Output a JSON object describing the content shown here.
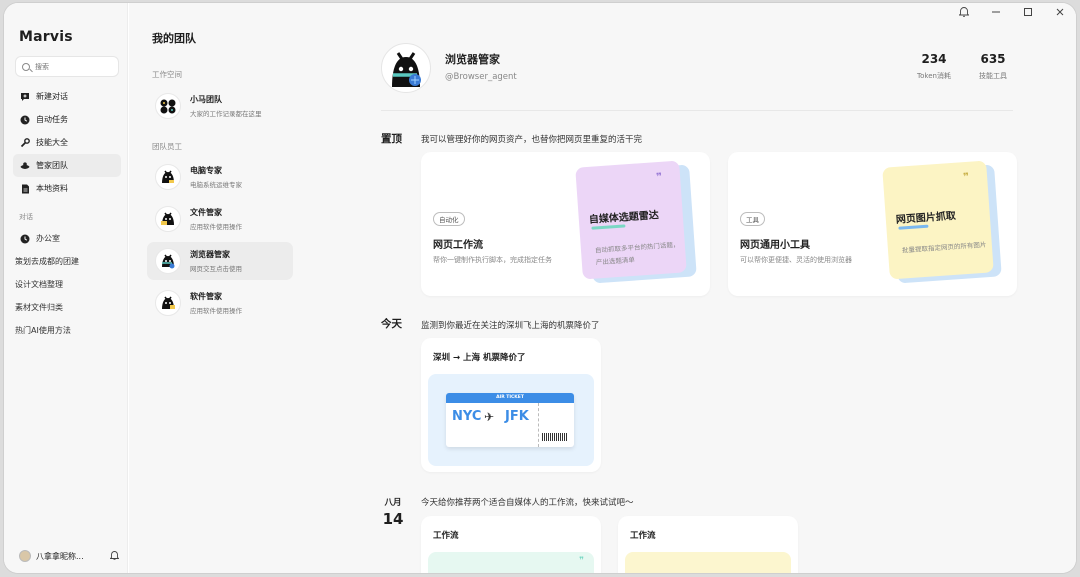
{
  "app": {
    "logo": "Marvis"
  },
  "sidebar": {
    "search_placeholder": "搜索",
    "items": [
      {
        "label": "新建对话",
        "icon": "chat-plus-icon"
      },
      {
        "label": "自动任务",
        "icon": "clock-icon"
      },
      {
        "label": "技能大全",
        "icon": "wrench-icon"
      },
      {
        "label": "管家团队",
        "icon": "team-icon",
        "active": true
      },
      {
        "label": "本地资料",
        "icon": "document-icon"
      }
    ],
    "conversations_label": "对话",
    "conversations": [
      {
        "label": "办公室",
        "icon": "clock-icon"
      },
      {
        "label": "策划去成都的团建"
      },
      {
        "label": "设计文档整理"
      },
      {
        "label": "素材文件归类"
      },
      {
        "label": "热门AI使用方法"
      }
    ],
    "user": {
      "name": "八拿拿昵称..."
    }
  },
  "team": {
    "title": "我的团队",
    "workspace_label": "工作空间",
    "workspace": {
      "name": "小马团队",
      "desc": "大家的工作记录都在这里"
    },
    "staff_label": "团队员工",
    "staff": [
      {
        "name": "电脑专家",
        "desc": "电脑系统运维专家"
      },
      {
        "name": "文件管家",
        "desc": "应用软件使用操作"
      },
      {
        "name": "浏览器管家",
        "desc": "网页交互点击使用",
        "active": true
      },
      {
        "name": "软件管家",
        "desc": "应用软件使用操作"
      }
    ]
  },
  "profile": {
    "name": "浏览器管家",
    "handle": "@Browser_agent",
    "stats": [
      {
        "value": "234",
        "label": "Token消耗"
      },
      {
        "value": "635",
        "label": "技能工具"
      }
    ]
  },
  "pinned": {
    "heading": "置顶",
    "desc": "我可以管理好你的网页资产，也替你把网页里重复的活干完",
    "cards": [
      {
        "tag": "自动化",
        "title": "网页工作流",
        "desc": "帮你一键制作执行脚本，完成指定任务",
        "note_title": "自媒体选题雷达",
        "note_desc": "自动抓取多平台的热门话题，产出选题清单",
        "note_color": "#ecd6f7",
        "note_back_color": "#cde3f8",
        "quote_color": "#9a7bd6",
        "highlight_color": "#7ad8c4"
      },
      {
        "tag": "工具",
        "title": "网页通用小工具",
        "desc": "可以帮你更便捷、灵活的使用浏览器",
        "note_title": "网页图片抓取",
        "note_desc": "批量提取指定网页的所有图片",
        "note_color": "#fcf4c4",
        "note_back_color": "#cde3f8",
        "quote_color": "#c9b14a",
        "highlight_color": "#7ab8f0"
      }
    ]
  },
  "today": {
    "heading": "今天",
    "desc": "监测到你最近在关注的深圳飞上海的机票降价了",
    "card_title": "深圳 → 上海  机票降价了",
    "ticket": {
      "header": "AIR TICKET",
      "from": "NYC",
      "to": "JFK"
    }
  },
  "recommend": {
    "month": "八月",
    "day": "14",
    "desc": "今天给你推荐两个适合自媒体人的工作流，快来试试吧～",
    "cards": [
      {
        "title": "工作流",
        "color": "#e6f8f1"
      },
      {
        "title": "工作流",
        "color": "#fcf6cf"
      }
    ]
  }
}
